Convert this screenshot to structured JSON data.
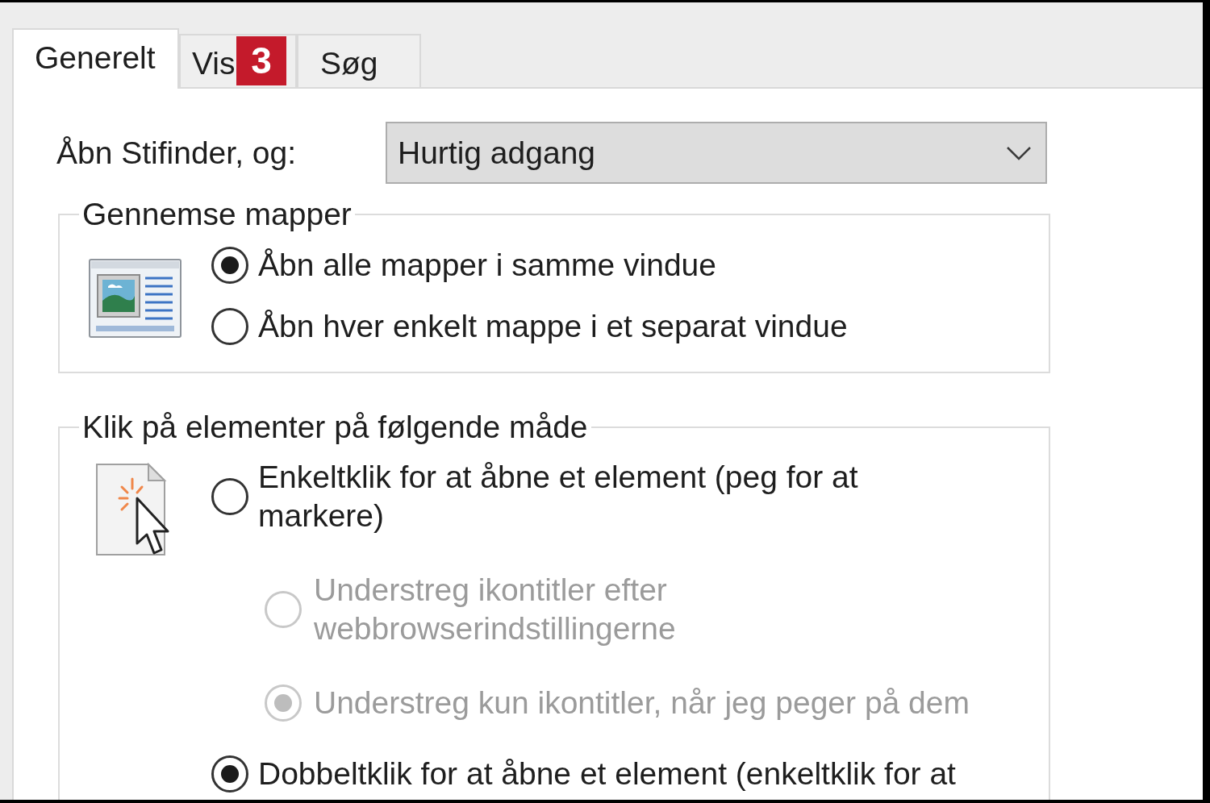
{
  "tabs": [
    {
      "label": "Generelt",
      "selected": true
    },
    {
      "label": "Vis",
      "selected": false,
      "callout": "3"
    },
    {
      "label": "Søg",
      "selected": false
    }
  ],
  "open_explorer": {
    "label": "Åbn Stifinder, og:",
    "value": "Hurtig adgang"
  },
  "browse_folders": {
    "title": "Gennemse mapper",
    "options": [
      {
        "label": "Åbn alle mapper i samme vindue",
        "selected": true
      },
      {
        "label": "Åbn hver enkelt mappe i et separat vindue",
        "selected": false
      }
    ]
  },
  "click_items": {
    "title": "Klik på elementer på følgende måde",
    "options": [
      {
        "label": "Enkeltklik for at åbne et element (peg for at markere)",
        "selected": false,
        "disabled": false,
        "children": [
          {
            "label": "Understreg ikontitler efter webbrowserindstillingerne",
            "selected": false,
            "disabled": true
          },
          {
            "label": "Understreg kun ikontitler, når jeg peger på dem",
            "selected": true,
            "disabled": true
          }
        ]
      },
      {
        "label": "Dobbeltklik for at åbne et element (enkeltklik for at",
        "selected": true,
        "disabled": false
      }
    ]
  }
}
